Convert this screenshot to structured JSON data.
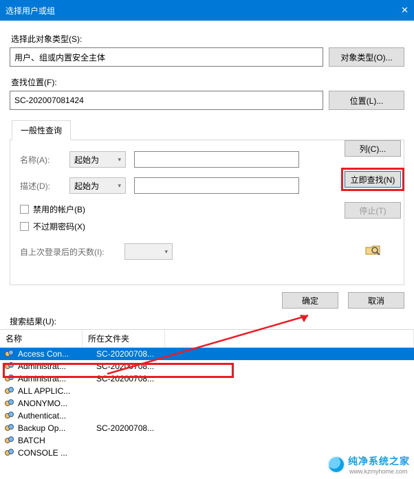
{
  "title": "选择用户或组",
  "section": {
    "objectType": {
      "label": "选择此对象类型(S):",
      "value": "用户、组或内置安全主体",
      "button": "对象类型(O)..."
    },
    "location": {
      "label": "查找位置(F):",
      "value": "SC-202007081424",
      "button": "位置(L)..."
    }
  },
  "tab": "一般性查询",
  "query": {
    "nameLabel": "名称(A):",
    "nameOp": "起始为",
    "descLabel": "描述(D):",
    "descOp": "起始为",
    "chkDisabled": "禁用的帐户(B)",
    "chkNoExpire": "不过期密码(X)",
    "daysLabel": "自上次登录后的天数(I):"
  },
  "rbtns": {
    "columns": "列(C)...",
    "findNow": "立即查找(N)",
    "stop": "停止(T)"
  },
  "actions": {
    "ok": "确定",
    "cancel": "取消"
  },
  "resultsLabel": "搜索结果(U):",
  "columns": {
    "name": "名称",
    "folder": "所在文件夹"
  },
  "rows": [
    {
      "name": "Access Con...",
      "folder": "SC-20200708..."
    },
    {
      "name": "Administrat...",
      "folder": "SC-20200708..."
    },
    {
      "name": "Administrat...",
      "folder": "SC-20200708..."
    },
    {
      "name": "ALL APPLIC...",
      "folder": ""
    },
    {
      "name": "ANONYMO...",
      "folder": ""
    },
    {
      "name": "Authenticat...",
      "folder": ""
    },
    {
      "name": "Backup Op...",
      "folder": "SC-20200708..."
    },
    {
      "name": "BATCH",
      "folder": ""
    },
    {
      "name": "CONSOLE ...",
      "folder": ""
    }
  ],
  "watermark": {
    "brand": "纯净系统之家",
    "url": "www.kzmyhome.com"
  }
}
